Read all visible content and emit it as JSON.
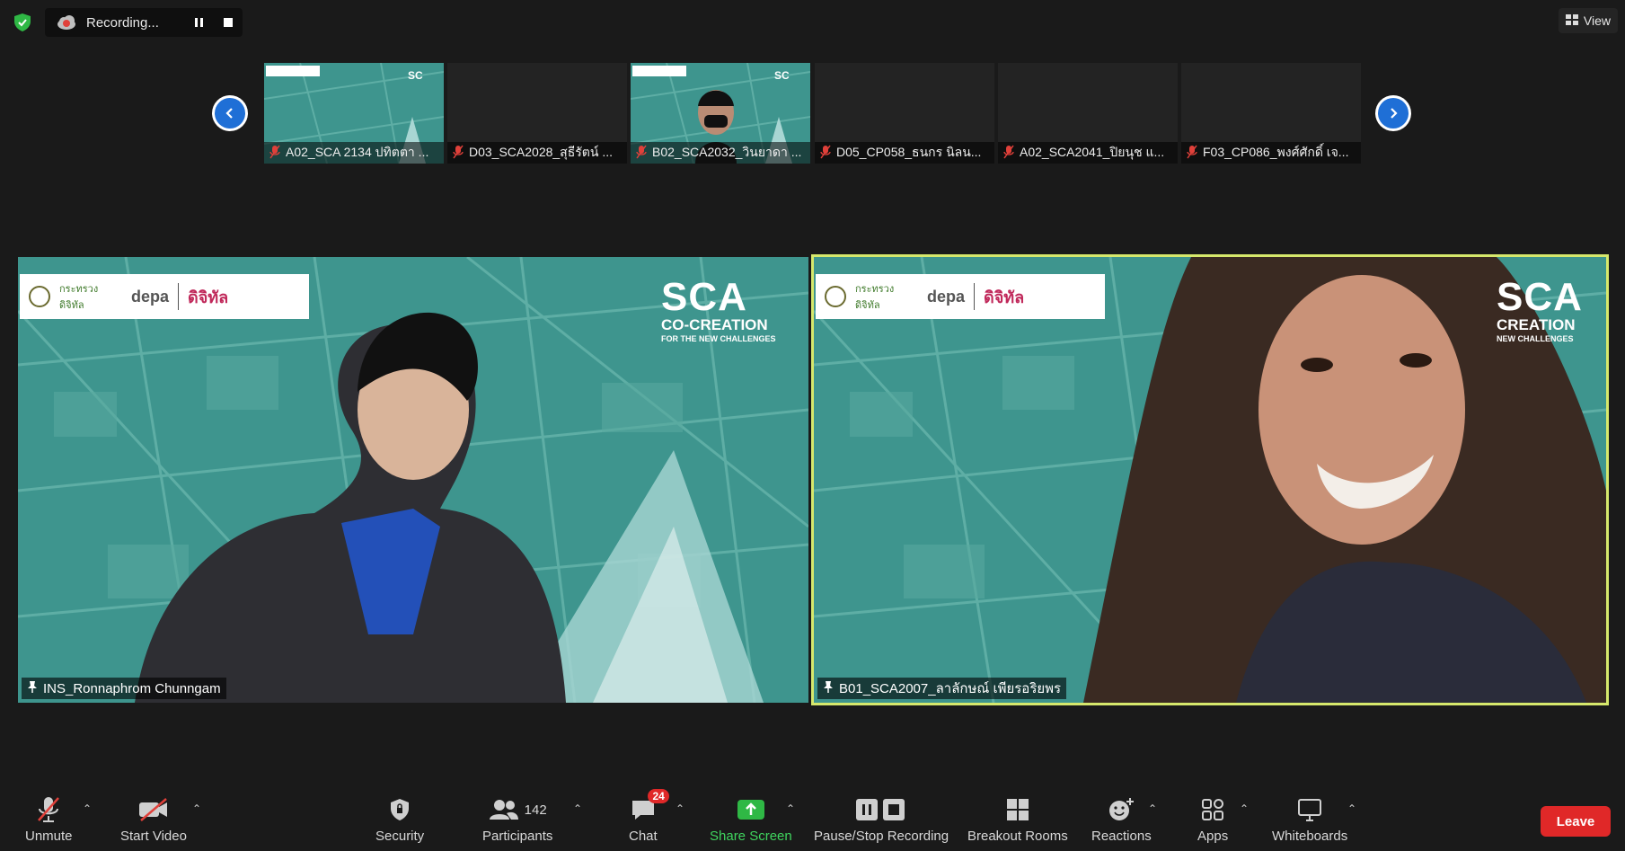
{
  "top_bar": {
    "recording_label": "Recording...",
    "view_label": "View"
  },
  "thumbnails": [
    {
      "name": "A02_SCA 2134 ปทิตตา ...",
      "has_video": true
    },
    {
      "name": "D03_SCA2028_สุธีรัตน์ ...",
      "has_video": false
    },
    {
      "name": "B02_SCA2032_วินยาดา ...",
      "has_video": true
    },
    {
      "name": "D05_CP058_ธนกร นิลน...",
      "has_video": false
    },
    {
      "name": "A02_SCA2041_ปิยนุช แ...",
      "has_video": false
    },
    {
      "name": "F03_CP086_พงศ์ศักดิ์ เจ...",
      "has_video": false
    }
  ],
  "videos": [
    {
      "name": "INS_Ronnaphrom Chunngam",
      "active_speaker": false,
      "logos": {
        "ministry": "กระทรวงดิจิทัล",
        "depa": "depa",
        "digital": "ดิจิทัล"
      },
      "brand": {
        "big": "SCA",
        "line1": "CO-CREATION",
        "line2": "FOR THE NEW CHALLENGES"
      }
    },
    {
      "name": "B01_SCA2007_ลาลักษณ์ เพียรอริยพร",
      "active_speaker": true,
      "logos": {
        "ministry": "กระทรวงดิจิทัล",
        "depa": "depa",
        "digital": "ดิจิทัล"
      },
      "brand": {
        "big": "SCA",
        "line1": "CREATION",
        "line2": "NEW CHALLENGES"
      }
    }
  ],
  "toolbar": {
    "unmute": "Unmute",
    "start_video": "Start Video",
    "security": "Security",
    "participants": "Participants",
    "participants_count": "142",
    "chat": "Chat",
    "chat_badge": "24",
    "share_screen": "Share Screen",
    "pause_stop_recording": "Pause/Stop Recording",
    "breakout_rooms": "Breakout Rooms",
    "reactions": "Reactions",
    "apps": "Apps",
    "whiteboards": "Whiteboards",
    "leave": "Leave"
  },
  "colors": {
    "accent_blue": "#1f6fd6",
    "speaker_outline": "#d6e86c",
    "leave_red": "#e02828",
    "share_green": "#3fd45e",
    "muted_red": "#e0403a"
  }
}
